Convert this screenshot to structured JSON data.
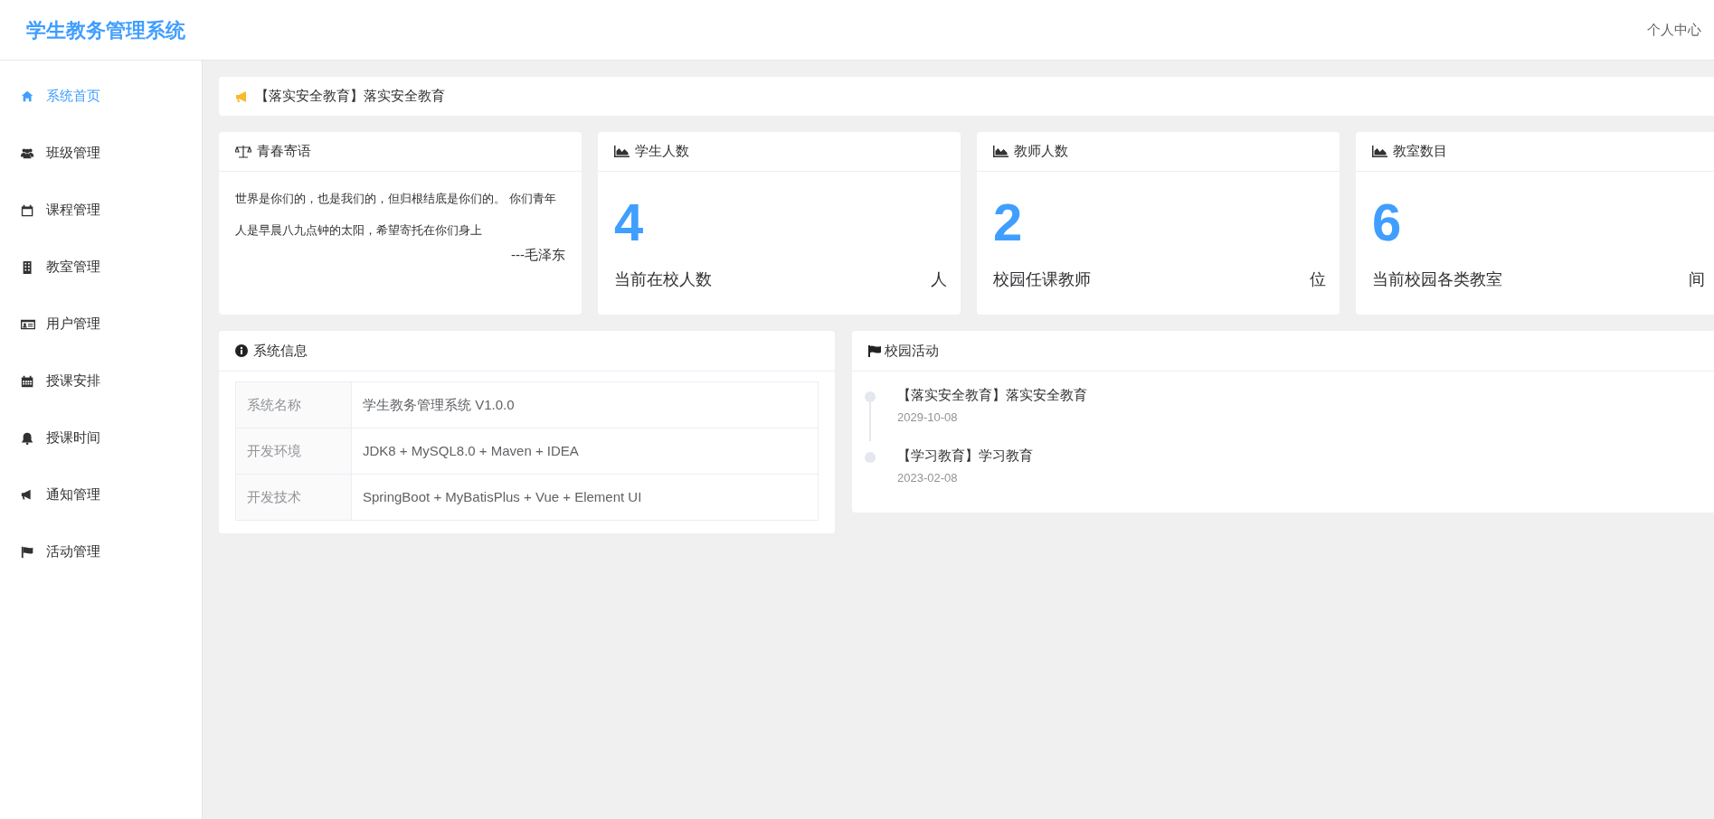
{
  "header": {
    "title": "学生教务管理系统",
    "user_menu": "个人中心"
  },
  "sidebar": {
    "items": [
      {
        "label": "系统首页",
        "selected": true
      },
      {
        "label": "班级管理",
        "selected": false
      },
      {
        "label": "课程管理",
        "selected": false
      },
      {
        "label": "教室管理",
        "selected": false
      },
      {
        "label": "用户管理",
        "selected": false
      },
      {
        "label": "授课安排",
        "selected": false
      },
      {
        "label": "授课时间",
        "selected": false
      },
      {
        "label": "通知管理",
        "selected": false
      },
      {
        "label": "活动管理",
        "selected": false
      }
    ]
  },
  "notice": {
    "text": "【落实安全教育】落实安全教育"
  },
  "quote_card": {
    "title": "青春寄语",
    "text": "世界是你们的，也是我们的，但归根结底是你们的。 你们青年人是早晨八九点钟的太阳，希望寄托在你们身上",
    "author": "---毛泽东"
  },
  "stat_cards": [
    {
      "title": "学生人数",
      "value": "4",
      "caption": "当前在校人数",
      "unit": "人"
    },
    {
      "title": "教师人数",
      "value": "2",
      "caption": "校园任课教师",
      "unit": "位"
    },
    {
      "title": "教室数目",
      "value": "6",
      "caption": "当前校园各类教室",
      "unit": "间"
    }
  ],
  "system_info": {
    "title": "系统信息",
    "rows": [
      {
        "label": "系统名称",
        "value": "学生教务管理系统 V1.0.0"
      },
      {
        "label": "开发环境",
        "value": "JDK8 + MySQL8.0 + Maven + IDEA"
      },
      {
        "label": "开发技术",
        "value": "SpringBoot + MyBatisPlus + Vue + Element UI"
      }
    ]
  },
  "activities": {
    "title": "校园活动",
    "items": [
      {
        "title": "【落实安全教育】落实安全教育",
        "date": "2029-10-08"
      },
      {
        "title": "【学习教育】学习教育",
        "date": "2023-02-08"
      }
    ]
  }
}
